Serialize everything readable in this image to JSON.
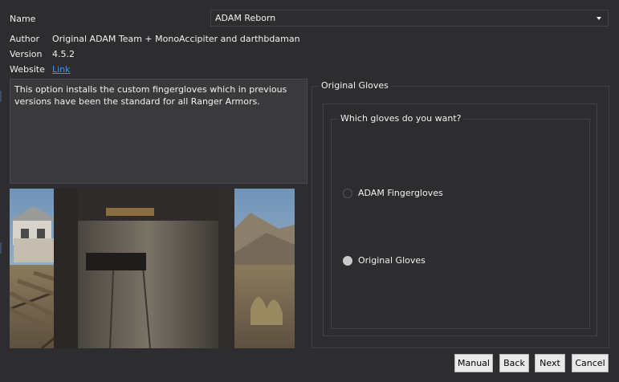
{
  "fields": {
    "name_label": "Name",
    "author_label": "Author",
    "author_value": "Original ADAM Team + MonoAccipiter and darthbdaman",
    "version_label": "Version",
    "version_value": "4.5.2",
    "website_label": "Website",
    "website_link": "Link"
  },
  "name_select": {
    "selected": "ADAM Reborn"
  },
  "description": "This option installs the custom fingergloves which in previous versions have been the standard for all Ranger Armors.",
  "outer_group": {
    "title": "Original Gloves"
  },
  "inner_group": {
    "title": "Which gloves do you want?"
  },
  "options": [
    {
      "label": "ADAM Fingergloves",
      "checked": false
    },
    {
      "label": "Original Gloves",
      "checked": true
    }
  ],
  "buttons": {
    "manual": "Manual",
    "back": "Back",
    "next": "Next",
    "cancel": "Cancel"
  }
}
